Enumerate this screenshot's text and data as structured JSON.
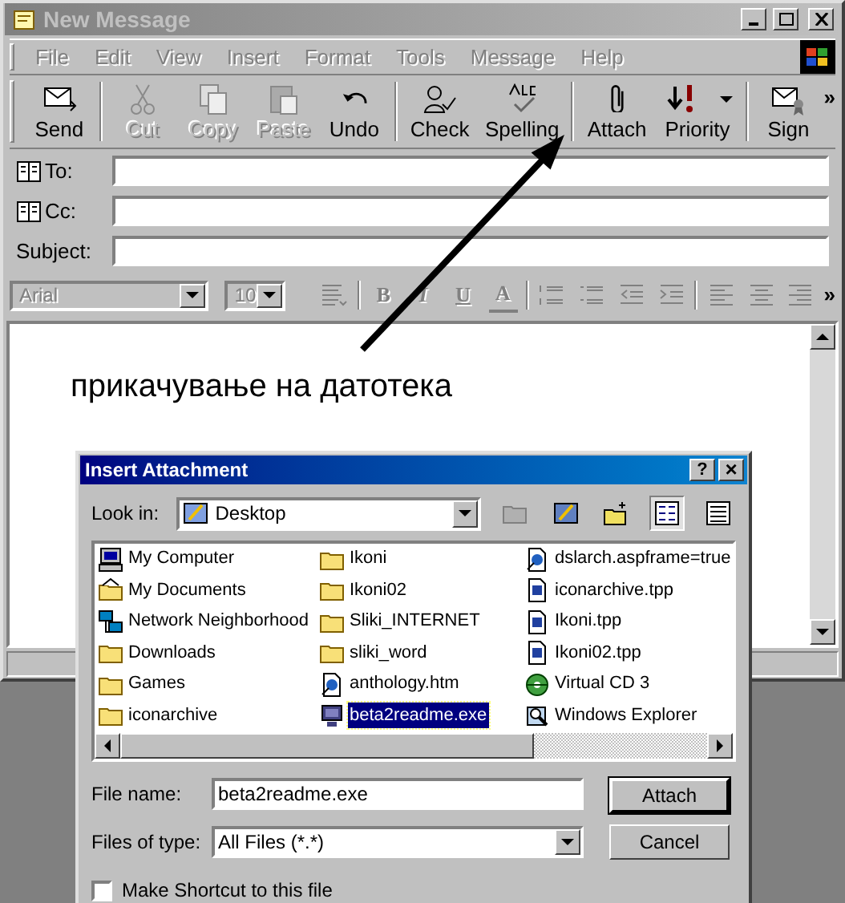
{
  "window": {
    "title": "New Message"
  },
  "menu": [
    {
      "label": "File"
    },
    {
      "label": "Edit"
    },
    {
      "label": "View"
    },
    {
      "label": "Insert"
    },
    {
      "label": "Format"
    },
    {
      "label": "Tools"
    },
    {
      "label": "Message"
    },
    {
      "label": "Help"
    }
  ],
  "toolbar": [
    {
      "kind": "send",
      "label": "Send",
      "disabled": false,
      "separator_after": true
    },
    {
      "kind": "cut",
      "label": "Cut",
      "disabled": true,
      "separator_after": false
    },
    {
      "kind": "copy",
      "label": "Copy",
      "disabled": true,
      "separator_after": false
    },
    {
      "kind": "paste",
      "label": "Paste",
      "disabled": true,
      "separator_after": false
    },
    {
      "kind": "undo",
      "label": "Undo",
      "disabled": false,
      "separator_after": true
    },
    {
      "kind": "check",
      "label": "Check",
      "disabled": false,
      "separator_after": false
    },
    {
      "kind": "spelling",
      "label": "Spelling",
      "disabled": false,
      "separator_after": true
    },
    {
      "kind": "attach",
      "label": "Attach",
      "disabled": false,
      "separator_after": false
    },
    {
      "kind": "priority",
      "label": "Priority",
      "disabled": false,
      "separator_after": true
    },
    {
      "kind": "sign",
      "label": "Sign",
      "disabled": false,
      "separator_after": false
    }
  ],
  "toolbar_overflow": "»",
  "header_fields": [
    {
      "kind": "address",
      "label": "To:"
    },
    {
      "kind": "address",
      "label": "Cc:"
    },
    {
      "kind": "plain",
      "label": "Subject:"
    }
  ],
  "format_bar": {
    "font": "Arial",
    "size": "10",
    "overflow": "»",
    "button_groups": [
      [
        {
          "kind": "paragraph"
        }
      ],
      [
        {
          "kind": "bold",
          "label": "B"
        },
        {
          "kind": "italic",
          "label": "I"
        },
        {
          "kind": "underline",
          "label": "U"
        },
        {
          "kind": "color",
          "label": "A"
        }
      ],
      [
        {
          "kind": "numbers"
        },
        {
          "kind": "bullets"
        },
        {
          "kind": "outdent"
        },
        {
          "kind": "indent"
        }
      ],
      [
        {
          "kind": "align-left"
        },
        {
          "kind": "align-center"
        },
        {
          "kind": "align-right"
        }
      ]
    ]
  },
  "annotation": "прикачување на датотека",
  "dialog": {
    "title": "Insert Attachment",
    "help": "?",
    "close": "×",
    "look_in_label": "Look in:",
    "look_in": "Desktop",
    "files": [
      {
        "kind": "computer",
        "name": "My Computer",
        "selected": false
      },
      {
        "kind": "documents",
        "name": "My Documents",
        "selected": false
      },
      {
        "kind": "network",
        "name": "Network Neighborhood",
        "selected": false
      },
      {
        "kind": "folder",
        "name": "Downloads",
        "selected": false
      },
      {
        "kind": "folder",
        "name": "Games",
        "selected": false
      },
      {
        "kind": "folder",
        "name": "iconarchive",
        "selected": false
      },
      {
        "kind": "folder",
        "name": "Ikoni",
        "selected": false
      },
      {
        "kind": "folder",
        "name": "Ikoni02",
        "selected": false
      },
      {
        "kind": "folder",
        "name": "Sliki_INTERNET",
        "selected": false
      },
      {
        "kind": "folder",
        "name": "sliki_word",
        "selected": false
      },
      {
        "kind": "web",
        "name": "anthology.htm",
        "selected": false
      },
      {
        "kind": "program",
        "name": "beta2readme.exe",
        "selected": true
      },
      {
        "kind": "web",
        "name": "dslarch.aspframe=true",
        "selected": false
      },
      {
        "kind": "document",
        "name": "iconarchive.tpp",
        "selected": false
      },
      {
        "kind": "document",
        "name": "Ikoni.tpp",
        "selected": false
      },
      {
        "kind": "document",
        "name": "Ikoni02.tpp",
        "selected": false
      },
      {
        "kind": "cd",
        "name": "Virtual CD 3",
        "selected": false
      },
      {
        "kind": "explorer",
        "name": "Windows Explorer",
        "selected": false
      }
    ],
    "file_name_label": "File name:",
    "file_name": "beta2readme.exe",
    "file_type_label": "Files of type:",
    "file_type": "All Files (*.*)",
    "buttons": [
      "Attach",
      "Cancel"
    ],
    "shortcut": {
      "label": "Make Shortcut to this file",
      "checked": false
    }
  }
}
